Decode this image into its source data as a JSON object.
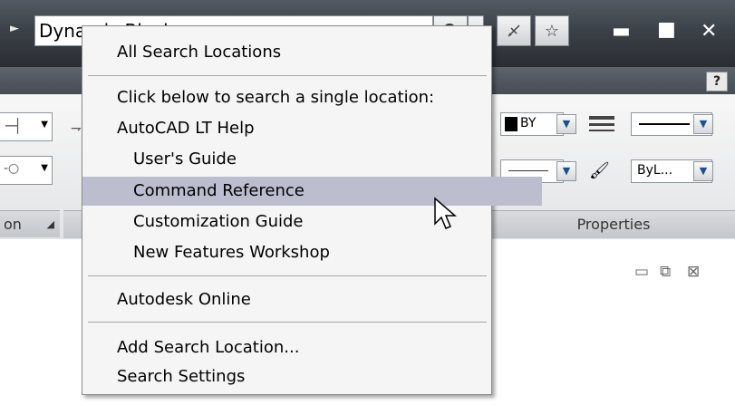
{
  "titlebar": {
    "search_value": "Dynamic Block",
    "arrow_icon": "triangle-right"
  },
  "ribbon": {
    "panel_left_footer": "on",
    "properties_footer": "Properties",
    "color_value": "BY",
    "plot_value": "ByL...",
    "help_label": "?"
  },
  "menu": {
    "all_locations": "All Search Locations",
    "single_location_header": "Click below to search a single location:",
    "items": [
      {
        "label": "AutoCAD LT Help"
      },
      {
        "label": "User's Guide"
      },
      {
        "label": "Command Reference"
      },
      {
        "label": "Customization Guide"
      },
      {
        "label": "New Features Workshop"
      }
    ],
    "autodesk_online": "Autodesk Online",
    "add_location": "Add Search Location...",
    "search_settings": "Search Settings"
  },
  "colors": {
    "highlight": "#bcbdcf",
    "titlebar": "#3b4148"
  }
}
